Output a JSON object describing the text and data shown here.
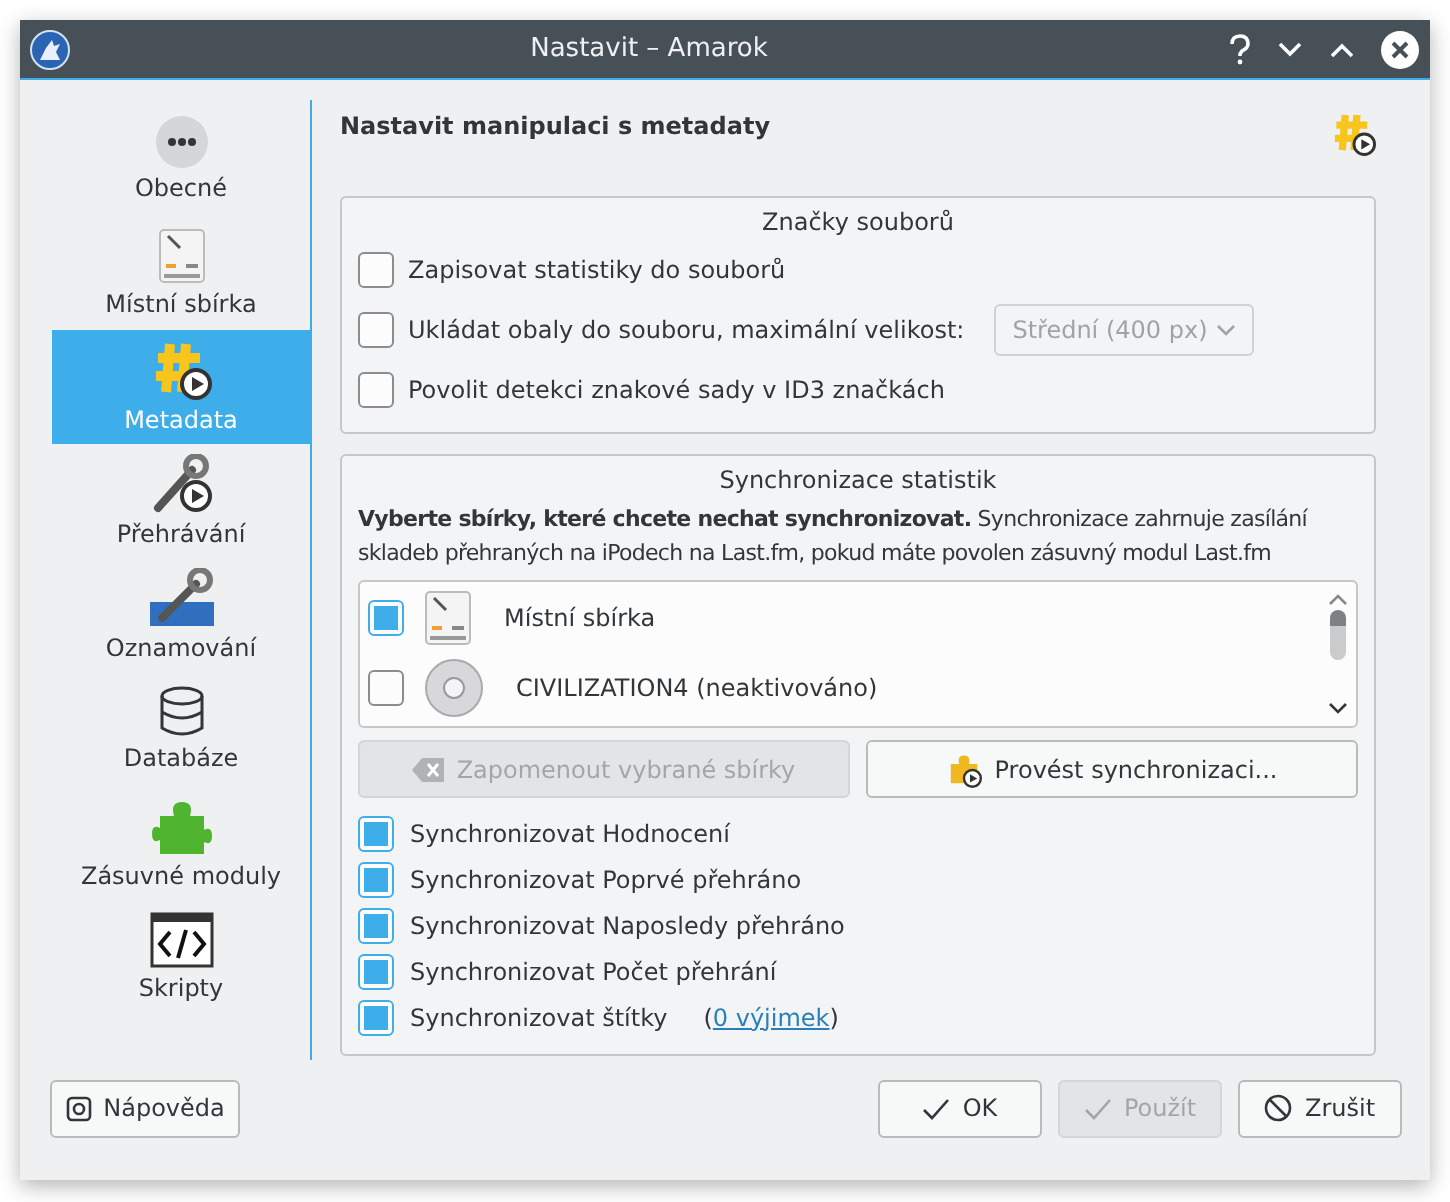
{
  "window": {
    "title": "Nastavit – Amarok"
  },
  "sidebar": {
    "items": [
      {
        "label": "Obecné",
        "selected": false
      },
      {
        "label": "Místní sbírka",
        "selected": false
      },
      {
        "label": "Metadata",
        "selected": true
      },
      {
        "label": "Přehrávání",
        "selected": false
      },
      {
        "label": "Oznamování",
        "selected": false
      },
      {
        "label": "Databáze",
        "selected": false
      },
      {
        "label": "Zásuvné moduly",
        "selected": false
      },
      {
        "label": "Skripty",
        "selected": false
      }
    ]
  },
  "page": {
    "title": "Nastavit manipulaci s metadaty"
  },
  "file_tags": {
    "title": "Značky souborů",
    "options": [
      {
        "kind": "checkbox",
        "label": "Zapisovat statistiky do souborů",
        "checked": false
      },
      {
        "kind": "checkbox-select",
        "label": "Ukládat obaly do souboru, maximální velikost:",
        "checked": false,
        "select": {
          "value": "Střední (400 px)",
          "disabled": true
        }
      },
      {
        "kind": "checkbox",
        "label": "Povolit detekci znakové sady v ID3 značkách",
        "checked": false
      }
    ]
  },
  "sync": {
    "title": "Synchronizace statistik",
    "description": "**Vyberte sbírky, které chcete nechat synchronizovat.** Synchronizace zahrnuje zasílání skladeb přehraných na iPodech na Last.fm, pokud máte povolen zásuvný modul Last.fm",
    "collections": [
      {
        "label": "Místní sbírka",
        "checked": true
      },
      {
        "label": "CIVILIZATION4 (neaktivováno)",
        "checked": false
      }
    ],
    "buttons": [
      {
        "label": "Zapomenout vybrané sbírky",
        "disabled": true
      },
      {
        "label": "Provést synchronizaci...",
        "disabled": false
      }
    ],
    "options": [
      {
        "label": "Synchronizovat Hodnocení",
        "checked": true
      },
      {
        "label": "Synchronizovat Poprvé přehráno",
        "checked": true
      },
      {
        "label": "Synchronizovat Naposledy přehráno",
        "checked": true
      },
      {
        "label": "Synchronizovat Počet přehrání",
        "checked": true
      },
      {
        "label": "Synchronizovat štítky",
        "checked": true,
        "note_before": "(",
        "link": "0 výjimek",
        "note_after": ")"
      }
    ]
  },
  "footer": {
    "help": {
      "label": "Nápověda"
    },
    "buttons": [
      {
        "label": "OK",
        "disabled": false
      },
      {
        "label": "Použít",
        "disabled": true
      },
      {
        "label": "Zrušit",
        "disabled": false
      }
    ]
  }
}
